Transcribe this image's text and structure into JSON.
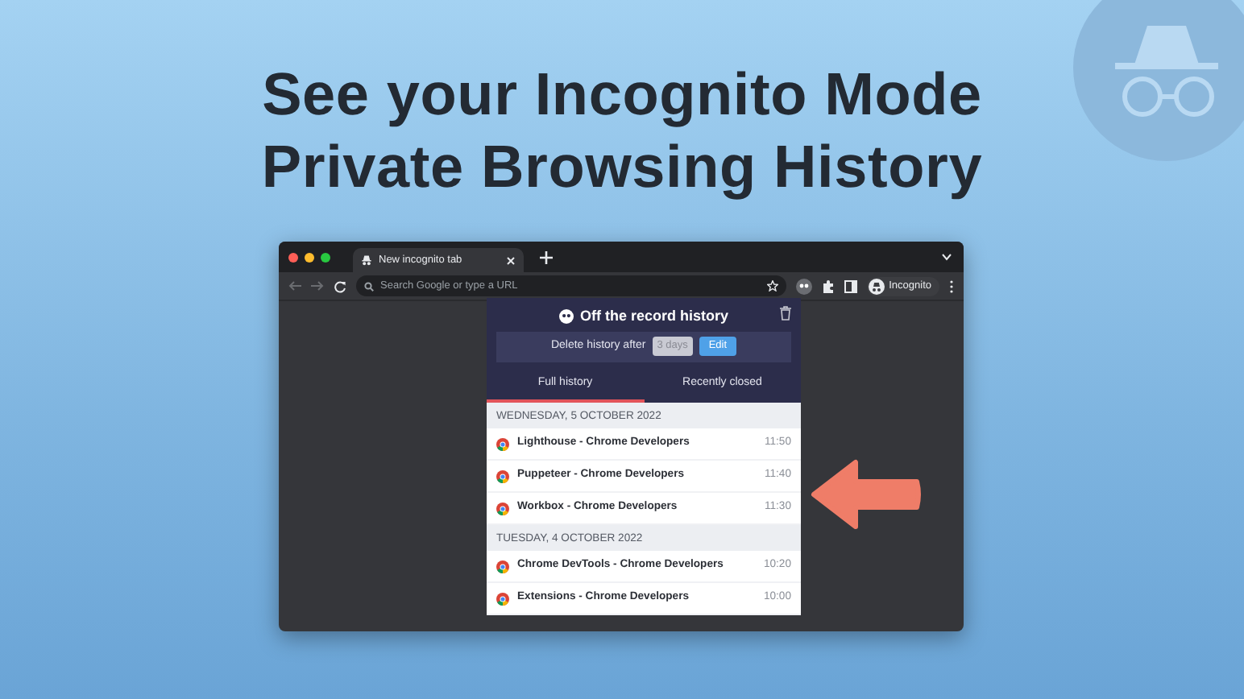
{
  "headline": [
    "See your Incognito Mode",
    "Private Browsing History"
  ],
  "browser": {
    "tab_title": "New incognito tab",
    "address_placeholder": "Search Google or type a URL",
    "profile_label": "Incognito"
  },
  "popup": {
    "title": "Off the record history",
    "delete_label": "Delete history after",
    "delete_value": "3 days",
    "edit_button": "Edit",
    "tabs": [
      {
        "label": "Full history",
        "selected": true
      },
      {
        "label": "Recently closed",
        "selected": false
      }
    ],
    "groups": [
      {
        "date": "WEDNESDAY, 5 OCTOBER 2022",
        "entries": [
          {
            "title": "Lighthouse - Chrome Developers",
            "time": "11:50"
          },
          {
            "title": "Puppeteer - Chrome Developers",
            "time": "11:40"
          },
          {
            "title": "Workbox - Chrome Developers",
            "time": "11:30"
          }
        ]
      },
      {
        "date": "TUESDAY, 4 OCTOBER 2022",
        "entries": [
          {
            "title": "Chrome DevTools - Chrome Developers",
            "time": "10:20"
          },
          {
            "title": "Extensions - Chrome Developers",
            "time": "10:00"
          }
        ]
      }
    ]
  }
}
